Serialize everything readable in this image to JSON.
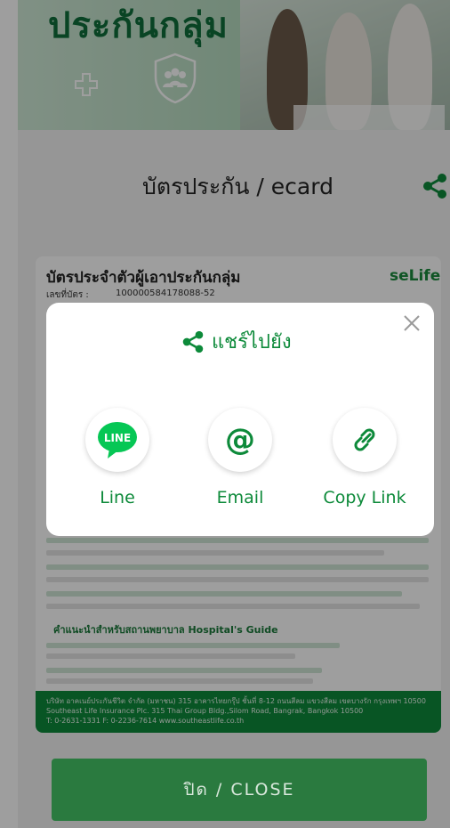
{
  "banner": {
    "title": "ประกันกลุ่ม"
  },
  "header": {
    "title": "บัตรประกัน / ecard",
    "share_icon": "share-icon"
  },
  "card": {
    "heading": "บัตรประจำตัวผู้เอาประกันกลุ่ม",
    "logo": "seLife",
    "number_label": "เลขที่บัตร :",
    "number_value": "100000584178088-52",
    "guide_heading": "คำแนะนำสำหรับสถานพยาบาล Hospital's Guide",
    "footer_lines": [
      "บริษัท อาคเนย์ประกันชีวิต จำกัด (มหาชน) 315 อาคารไทยกรุ๊ป ชั้นที่ 8-12 ถนนสีลม แขวงสีลม เขตบางรัก กรุงเทพฯ 10500",
      "Southeast Life Insurance Plc. 315 Thai Group Bldg.,Silom Road, Bangrak, Bangkok 10500",
      "T: 0-2631-1331 F: 0-2236-7614 www.southeastlife.co.th"
    ]
  },
  "dialog": {
    "title": "แชร์ไปยัง",
    "options": [
      {
        "label": "Line",
        "icon": "line-app-icon"
      },
      {
        "label": "Email",
        "icon": "at-sign-icon"
      },
      {
        "label": "Copy Link",
        "icon": "link-icon"
      }
    ]
  },
  "close_button": {
    "label": "ปิด / CLOSE"
  },
  "colors": {
    "brand_green": "#0d8a3a",
    "close_button": "#2a7a3f",
    "line_green": "#06c755"
  }
}
